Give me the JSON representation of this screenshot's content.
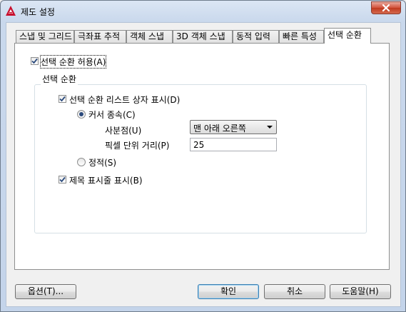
{
  "window": {
    "title": "제도 설정"
  },
  "tabs": [
    {
      "label": "스냅 및 그리드"
    },
    {
      "label": "극좌표 추적"
    },
    {
      "label": "객체 스냅"
    },
    {
      "label": "3D 객체 스냅"
    },
    {
      "label": "동적 입력"
    },
    {
      "label": "빠른 특성"
    },
    {
      "label": "선택 순환",
      "active": true
    }
  ],
  "panel": {
    "allow_cycling": {
      "label": "선택 순환 허용(A)",
      "checked": true
    },
    "group_title": "선택 순환",
    "show_list_box": {
      "label": "선택 순환 리스트 상자 표시(D)",
      "checked": true
    },
    "cursor_dependent": {
      "label": "커서 종속(C)",
      "selected": true
    },
    "quadrant_label": "사분점(U)",
    "quadrant_value": "맨 아래 오른쪽",
    "pixel_distance_label": "픽셀 단위 거리(P)",
    "pixel_distance_value": "25",
    "static": {
      "label": "정적(S)",
      "selected": false
    },
    "show_title_bar": {
      "label": "제목 표시줄 표시(B)",
      "checked": true
    }
  },
  "buttons": {
    "options": "옵션(T)...",
    "ok": "확인",
    "cancel": "취소",
    "help": "도움말(H)"
  }
}
